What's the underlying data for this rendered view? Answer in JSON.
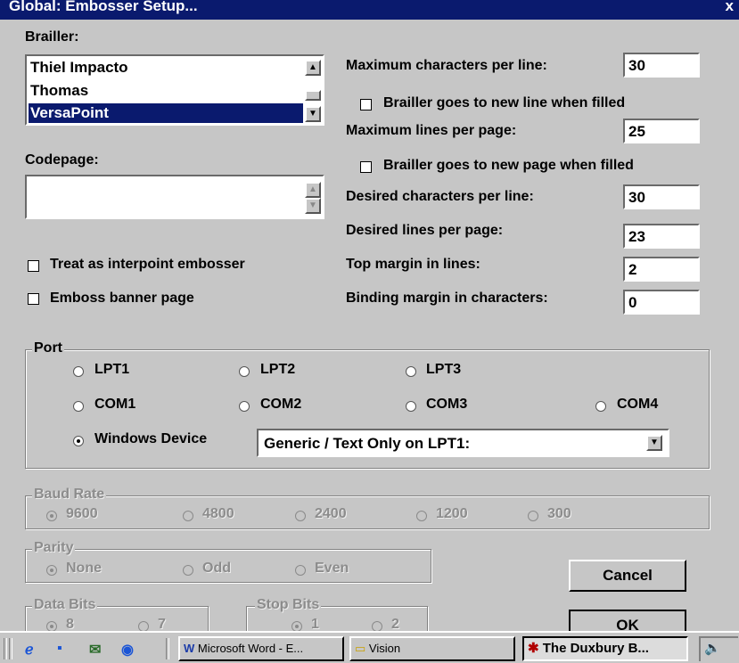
{
  "window": {
    "title": "Global: Embosser Setup...",
    "close_glyph": "x"
  },
  "brailler": {
    "label": "Brailler:",
    "items": [
      "Thiel Impacto",
      "Thomas",
      "VersaPoint"
    ],
    "selected": "VersaPoint"
  },
  "codepage": {
    "label": "Codepage:",
    "items": []
  },
  "options": {
    "interpoint": {
      "label": "Treat as interpoint embosser",
      "checked": false
    },
    "banner": {
      "label": "Emboss banner page",
      "checked": false
    }
  },
  "settings": {
    "max_chars": {
      "label": "Maximum characters per line:",
      "value": "30"
    },
    "newline_when_filled": {
      "label": "Brailler goes to new line when filled",
      "checked": false
    },
    "max_lines": {
      "label": "Maximum lines per page:",
      "value": "25"
    },
    "newpage_when_filled": {
      "label": "Brailler goes to new page when filled",
      "checked": false
    },
    "desired_chars": {
      "label": "Desired characters per line:",
      "value": "30"
    },
    "desired_lines": {
      "label": "Desired lines per page:",
      "value": "23"
    },
    "top_margin": {
      "label": "Top margin in lines:",
      "value": "2"
    },
    "binding_margin": {
      "label": "Binding margin in characters:",
      "value": "0"
    }
  },
  "port": {
    "label": "Port",
    "options": [
      "LPT1",
      "LPT2",
      "LPT3",
      "COM1",
      "COM2",
      "COM3",
      "COM4",
      "Windows Device"
    ],
    "selected": "Windows Device",
    "device": "Generic / Text Only on LPT1:"
  },
  "baud": {
    "label": "Baud Rate",
    "options": [
      "9600",
      "4800",
      "2400",
      "1200",
      "300"
    ],
    "selected": "9600"
  },
  "parity": {
    "label": "Parity",
    "options": [
      "None",
      "Odd",
      "Even"
    ],
    "selected": "None"
  },
  "databits": {
    "label": "Data Bits",
    "options": [
      "8",
      "7"
    ],
    "selected": "8"
  },
  "stopbits": {
    "label": "Stop Bits",
    "options": [
      "1",
      "2"
    ],
    "selected": "1"
  },
  "buttons": {
    "cancel": "Cancel",
    "ok": "OK"
  },
  "taskbar": {
    "items": [
      {
        "label": "Microsoft Word - E...",
        "icon": "word-icon",
        "active": false
      },
      {
        "label": "Vision",
        "icon": "folder-icon",
        "active": false
      },
      {
        "label": "The Duxbury B...",
        "icon": "duxbury-icon",
        "active": true
      }
    ],
    "quick_launch_icons": [
      "ie-icon",
      "desktop-icon",
      "outlook-icon",
      "channel-icon"
    ],
    "tray_icons": [
      "speaker-icon"
    ]
  },
  "colors": {
    "titlebar": "#0a1a6e",
    "dialog": "#c6c6c6",
    "selection": "#0a1a6e"
  }
}
